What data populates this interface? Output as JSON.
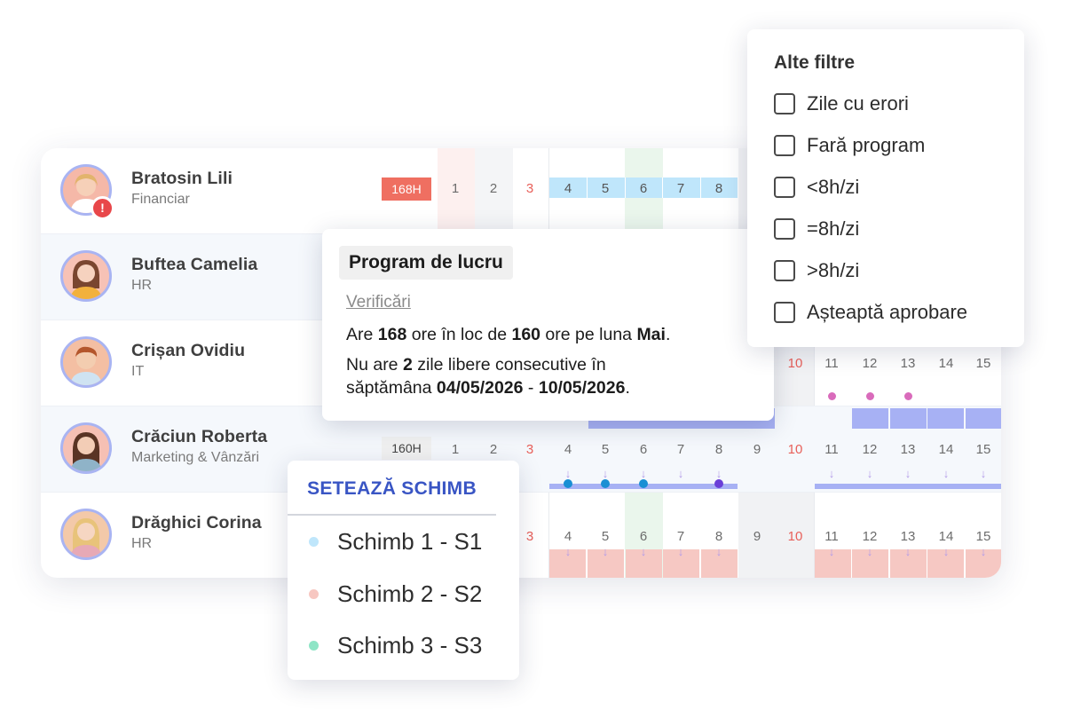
{
  "employees": [
    {
      "name": "Bratosin Lili",
      "dept": "Financiar",
      "hours": "168H",
      "avatar_color": "#f5b8a8",
      "alert_icon": "!"
    },
    {
      "name": "Buftea Camelia",
      "dept": "HR",
      "avatar_color": "#f7c2b6"
    },
    {
      "name": "Crișan Ovidiu",
      "dept": "IT",
      "avatar_color": "#f4bfa3"
    },
    {
      "name": "Crăciun Roberta",
      "dept": "Marketing & Vânzări",
      "hours": "160H",
      "avatar_color": "#f6c0b4"
    },
    {
      "name": "Drăghici Corina",
      "dept": "HR",
      "avatar_color": "#f3c9a9"
    }
  ],
  "calendar": {
    "days": [
      "1",
      "2",
      "3",
      "4",
      "5",
      "6",
      "7",
      "8",
      "9",
      "10",
      "11",
      "12",
      "13",
      "14",
      "15"
    ],
    "weekend_days": [
      "3",
      "10"
    ]
  },
  "tooltip": {
    "title": "Program de lucru",
    "subtitle": "Verificări",
    "line1": {
      "a": "Are ",
      "b": "168",
      "c": " ore în loc de ",
      "d": "160",
      "e": " ore pe luna ",
      "f": "Mai",
      "g": "."
    },
    "line2": "Nu are ",
    "line2_bold": "2",
    "line2_rest": " zile libere consecutive în",
    "line3_a": "săptămâna ",
    "line3_b": "04/05/2026",
    "line3_c": " - ",
    "line3_d": "10/05/2026",
    "line3_e": "."
  },
  "filters": {
    "title": "Alte filtre",
    "options": [
      "Zile cu erori",
      "Fară program",
      "<8h/zi",
      "=8h/zi",
      ">8h/zi",
      "Așteaptă aprobare"
    ]
  },
  "shift_menu": {
    "title": "SETEAZĂ SCHIMB",
    "options": [
      {
        "label": "Schimb 1 - S1",
        "color": "#bfe6fb"
      },
      {
        "label": "Schimb 2 - S2",
        "color": "#f7c7c1"
      },
      {
        "label": "Schimb 3 - S3",
        "color": "#8ee5c6"
      }
    ]
  },
  "colors": {
    "shift1": "#bfe6fb",
    "shift2": "#f6c8c3",
    "shift3": "#a7b1f4",
    "weekend_band": "#f2f3f5",
    "today_band": "#eaf6ec",
    "first_col_band": "#fdf0ef",
    "accent": "#3955c4"
  }
}
